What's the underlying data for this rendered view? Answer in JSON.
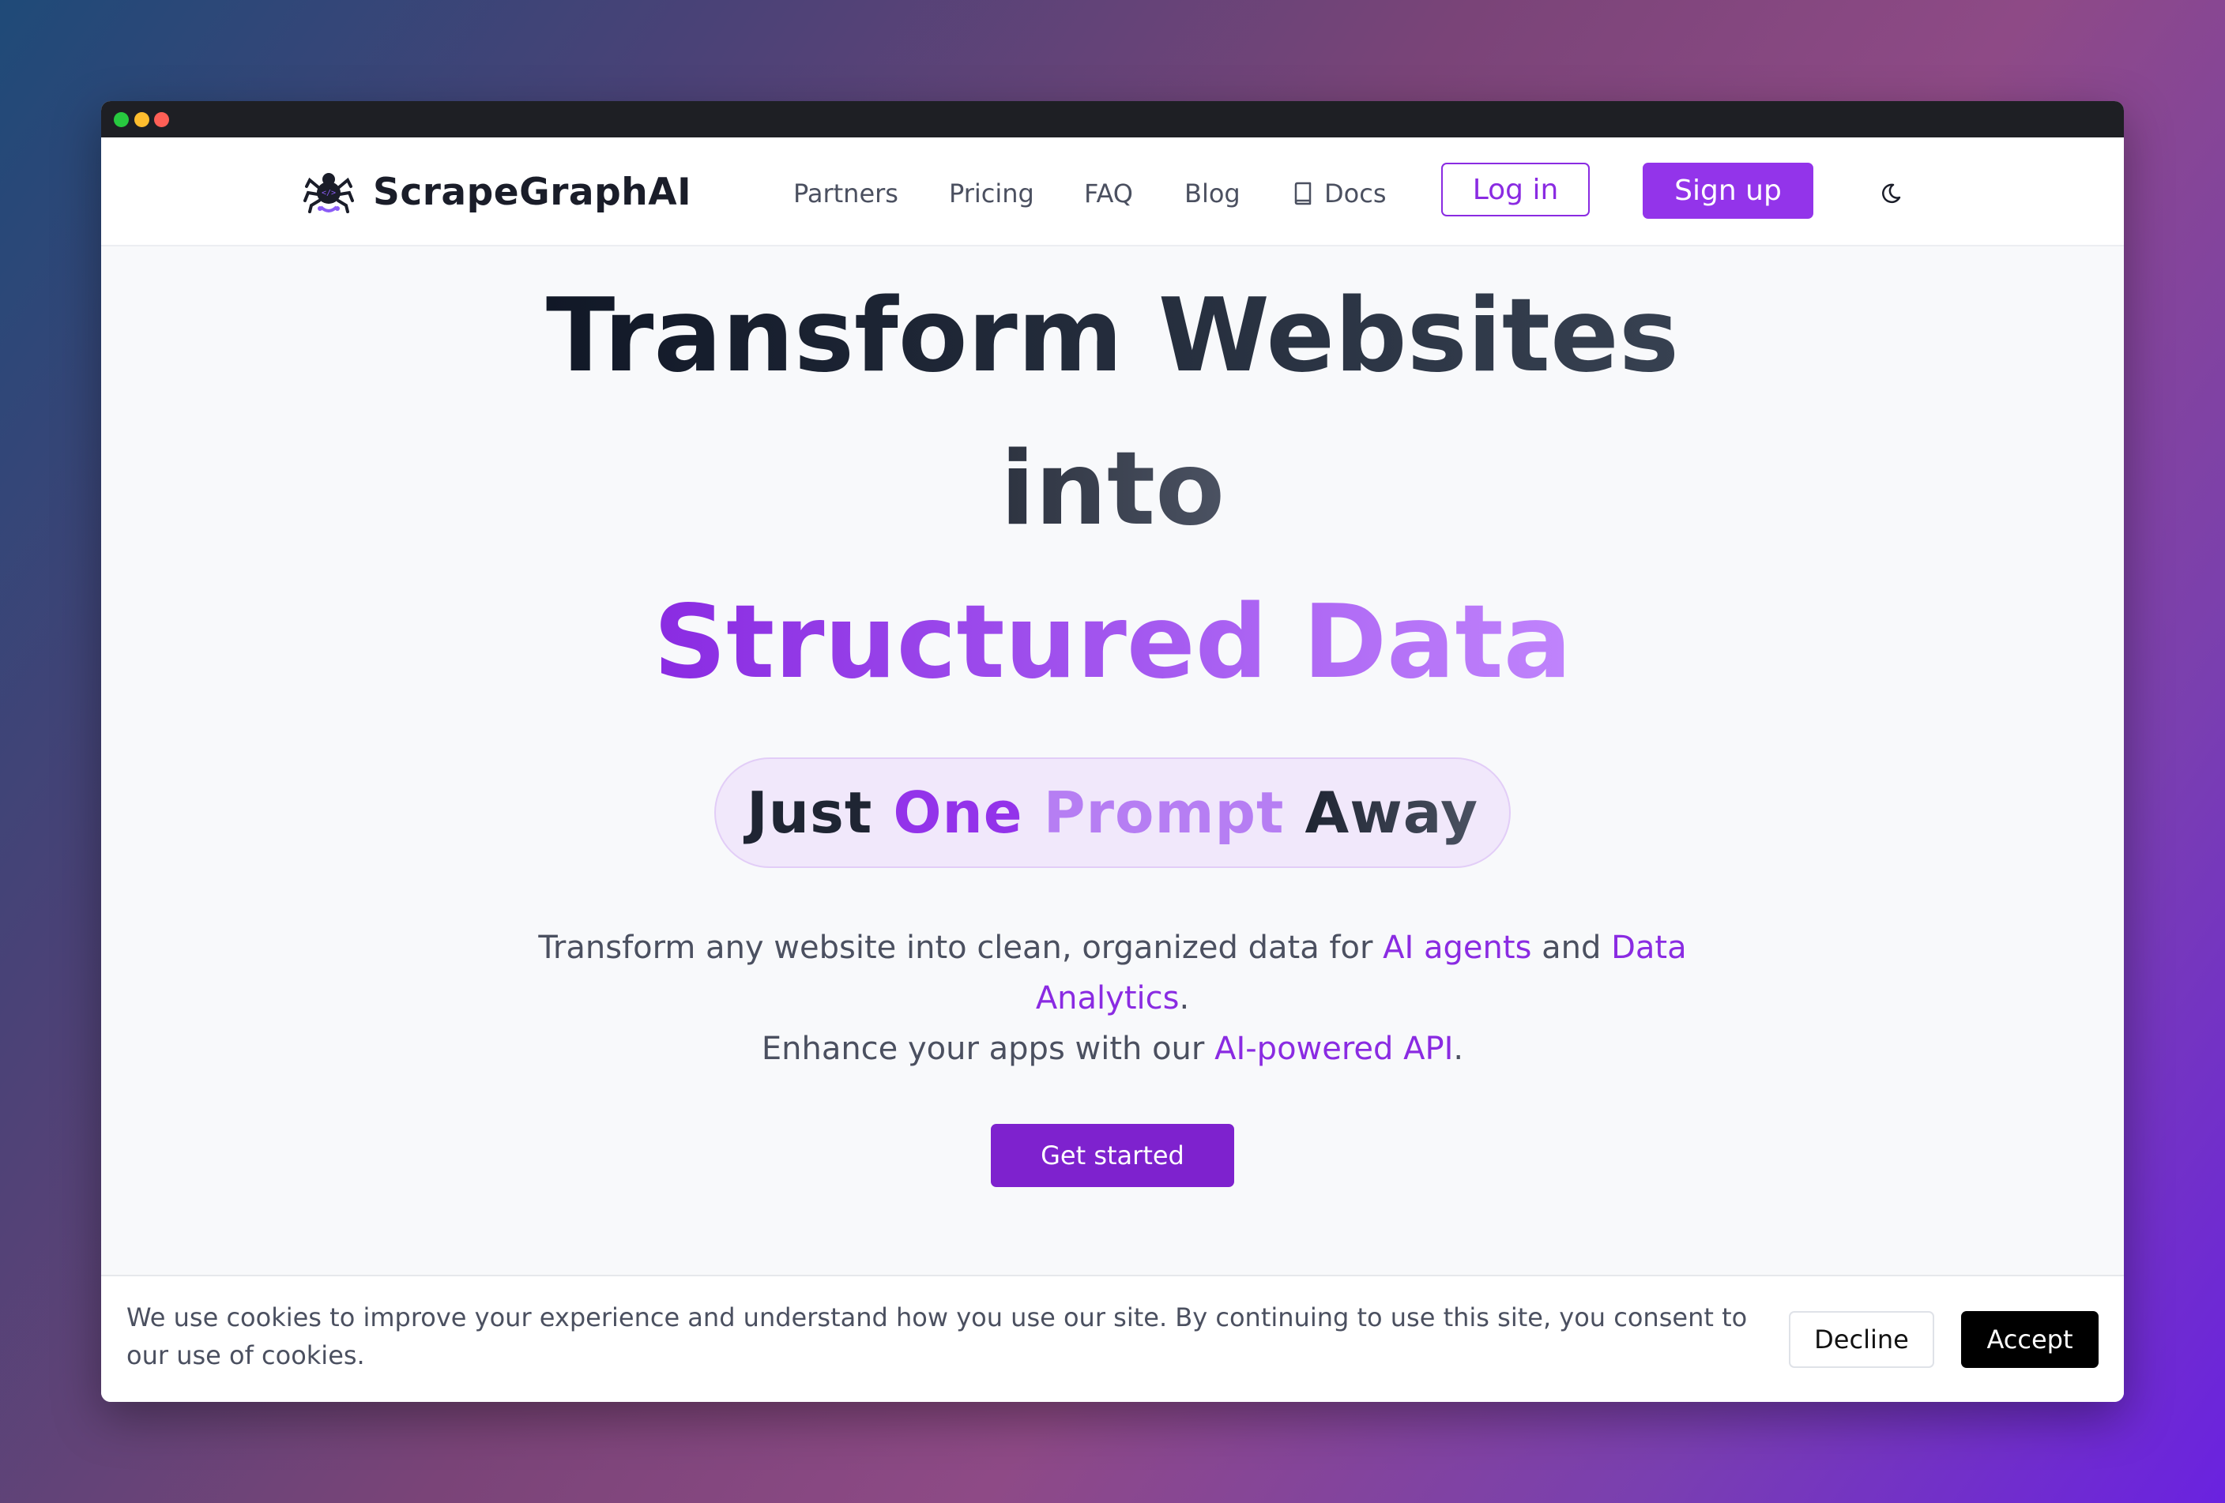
{
  "window": {
    "traffic_lights": [
      "#27c93f",
      "#ffbd2e",
      "#ff5f56"
    ]
  },
  "navbar": {
    "brand": "ScrapeGraphAI",
    "links": [
      "Partners",
      "Pricing",
      "FAQ",
      "Blog"
    ],
    "docs_label": "Docs",
    "login_label": "Log in",
    "signup_label": "Sign up",
    "theme_icon": "moon-icon"
  },
  "hero": {
    "title_line1": "Transform Websites",
    "title_line2": "into",
    "title_line3": "Structured Data",
    "pill": {
      "just": "Just ",
      "one": "One ",
      "prompt": "Prompt ",
      "away": "Away"
    },
    "desc": {
      "part1": "Transform any website into clean, organized data for ",
      "ai_agents": "AI agents",
      "and": " and ",
      "data": "Data",
      "analytics": "Analytics",
      "period1": ".",
      "part2": "Enhance your apps with our ",
      "api": "AI-powered API",
      "period2": "."
    },
    "cta_label": "Get started"
  },
  "cookie": {
    "text": "We use cookies to improve your experience and understand how you use our site. By continuing to use this site, you consent to our use of cookies.",
    "decline_label": "Decline",
    "accept_label": "Accept"
  },
  "colors": {
    "accent": "#9334ea",
    "cta": "#7e22ce",
    "text_dark": "#111827"
  }
}
